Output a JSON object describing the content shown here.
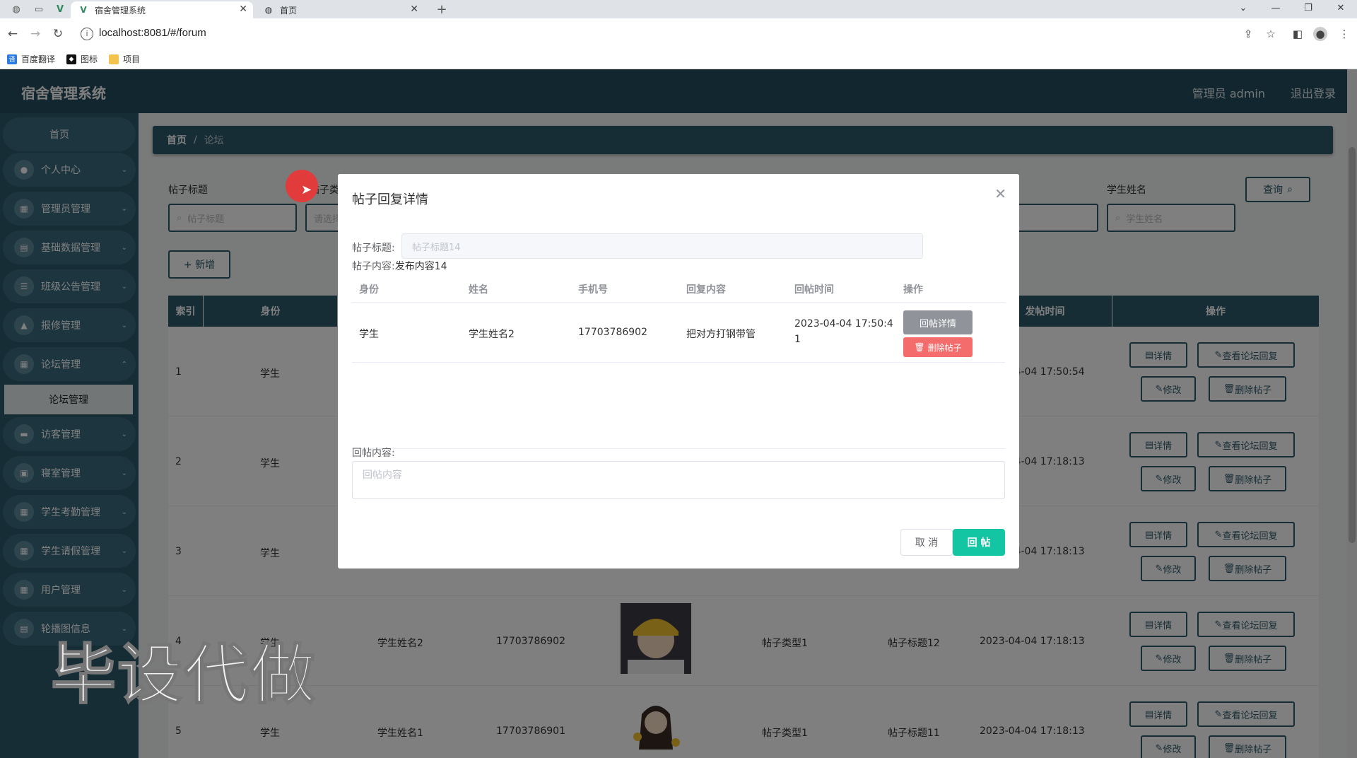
{
  "browser": {
    "tabs": [
      {
        "label": "宿舍管理系统",
        "active": true
      },
      {
        "label": "首页",
        "active": false
      }
    ],
    "url": "localhost:8081/#/forum",
    "bookmarks": [
      "百度翻译",
      "图标",
      "项目"
    ]
  },
  "header": {
    "title": "宿舍管理系统",
    "admin": "管理员 admin",
    "logout": "退出登录"
  },
  "sidebar": {
    "home": "首页",
    "items": [
      "个人中心",
      "管理员管理",
      "基础数据管理",
      "班级公告管理",
      "报修管理",
      "论坛管理",
      "访客管理",
      "寝室管理",
      "学生考勤管理",
      "学生请假管理",
      "用户管理",
      "轮播图信息"
    ],
    "active_sub": "论坛管理"
  },
  "breadcrumb": {
    "home": "首页",
    "sep": "/",
    "current": "论坛"
  },
  "filters": {
    "title_label": "帖子标题",
    "title_placeholder": "帖子标题",
    "type_label": "帖子类型",
    "type_placeholder": "请选择",
    "student_label": "学生姓名",
    "student_placeholder": "学生姓名",
    "query_button": "查询",
    "add_button": "+ 新增"
  },
  "table": {
    "headers": [
      "索引",
      "身份",
      "发帖时间",
      "操作"
    ],
    "rows": [
      {
        "index": "1",
        "role": "学生",
        "name": "",
        "phone": "",
        "type": "",
        "title": "",
        "time": "2023-04-04 17:50:54"
      },
      {
        "index": "2",
        "role": "学生",
        "name": "",
        "phone": "",
        "type": "",
        "title": "",
        "time": "2023-04-04 17:18:13"
      },
      {
        "index": "3",
        "role": "学生",
        "name": "",
        "phone": "",
        "type": "",
        "title": "",
        "time": "2023-04-04 17:18:13"
      },
      {
        "index": "4",
        "role": "学生",
        "name": "学生姓名2",
        "phone": "17703786902",
        "type": "帖子类型1",
        "title": "帖子标题12",
        "time": "2023-04-04 17:18:13"
      },
      {
        "index": "5",
        "role": "学生",
        "name": "学生姓名1",
        "phone": "17703786901",
        "type": "帖子类型1",
        "title": "帖子标题11",
        "time": "2023-04-04 17:18:13"
      }
    ],
    "ops": {
      "detail": "详情",
      "view_reply": "查看论坛回复",
      "edit": "修改",
      "delete": "删除帖子"
    }
  },
  "dialog": {
    "title": "帖子回复详情",
    "post_title_label": "帖子标题:",
    "post_title_value": "帖子标题14",
    "post_content_label": "帖子内容:",
    "post_content_value": "发布内容14",
    "columns": [
      "身份",
      "姓名",
      "手机号",
      "回复内容",
      "回帖时间",
      "操作"
    ],
    "reply": {
      "role": "学生",
      "name": "学生姓名2",
      "phone": "17703786902",
      "content": "把对方打钢带管",
      "time_line1": "2023-04-04 17:50:4",
      "time_line2": "1",
      "detail_button": "回帖详情",
      "delete_button": "删除帖子"
    },
    "reply_label": "回帖内容:",
    "reply_placeholder": "回帖内容",
    "cancel": "取 消",
    "submit": "回 帖"
  },
  "watermark": "毕设代做",
  "colors": {
    "primary": "#2f5a6c",
    "header": "#244d5f",
    "accent": "#13c5a3",
    "danger": "#f56c6c"
  }
}
